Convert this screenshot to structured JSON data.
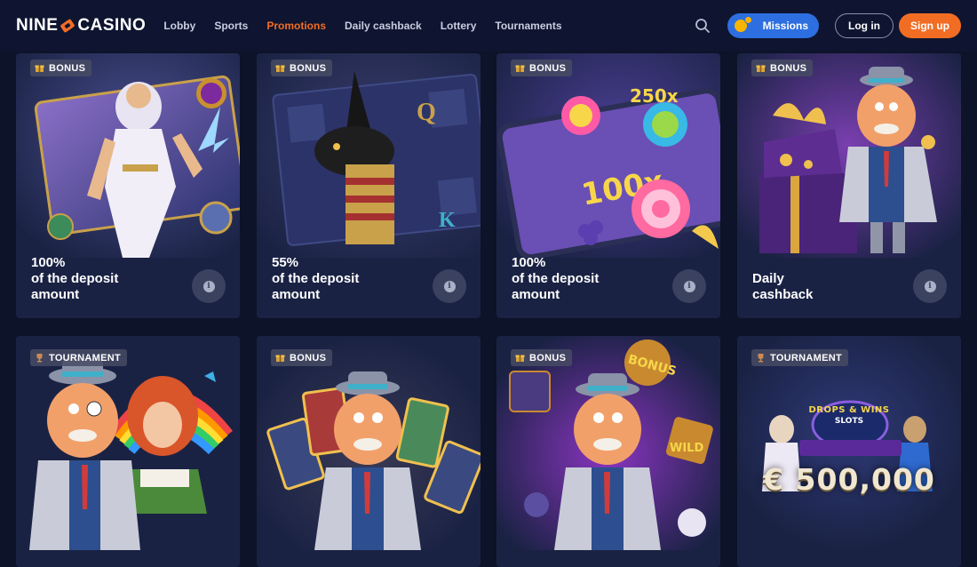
{
  "brand": {
    "left": "NINE",
    "right": "CASINO"
  },
  "nav": [
    {
      "label": "Lobby",
      "active": false
    },
    {
      "label": "Sports",
      "active": false
    },
    {
      "label": "Promotions",
      "active": true
    },
    {
      "label": "Daily cashback",
      "active": false
    },
    {
      "label": "Lottery",
      "active": false
    },
    {
      "label": "Tournaments",
      "active": false
    }
  ],
  "header": {
    "search_icon": "search-icon",
    "missions_label": "Missions",
    "login_label": "Log in",
    "signup_label": "Sign up"
  },
  "colors": {
    "accent": "#f26d24",
    "missions": "#2d6fe0",
    "card_bg": "#1a2244",
    "page_bg": "#0d1328"
  },
  "cards": [
    {
      "badge": "BONUS",
      "badge_icon": "gift-icon",
      "title_l1": "100%",
      "title_l2": "of the deposit",
      "title_l3": "amount",
      "art": "zeus-slot-art"
    },
    {
      "badge": "BONUS",
      "badge_icon": "gift-icon",
      "title_l1": "55%",
      "title_l2": "of the deposit",
      "title_l3": "amount",
      "art": "anubis-slot-art"
    },
    {
      "badge": "BONUS",
      "badge_icon": "gift-icon",
      "title_l1": "100%",
      "title_l2": "of the deposit",
      "title_l3": "amount",
      "art": "candy-slot-art"
    },
    {
      "badge": "BONUS",
      "badge_icon": "gift-icon",
      "title_l1": "Daily",
      "title_l2": "cashback",
      "title_l3": "",
      "art": "mascot-gift-art"
    },
    {
      "badge": "TOURNAMENT",
      "badge_icon": "trophy-icon",
      "art": "mascot-fairy-art"
    },
    {
      "badge": "BONUS",
      "badge_icon": "gift-icon",
      "art": "mascot-cards-art"
    },
    {
      "badge": "BONUS",
      "badge_icon": "gift-icon",
      "art": "mascot-bonus-art"
    },
    {
      "badge": "TOURNAMENT",
      "badge_icon": "trophy-icon",
      "art": "drops-wins-art",
      "jackpot": "€ 500,000",
      "banner_line1": "DROPS & WINS",
      "banner_line2": "SLOTS"
    }
  ]
}
